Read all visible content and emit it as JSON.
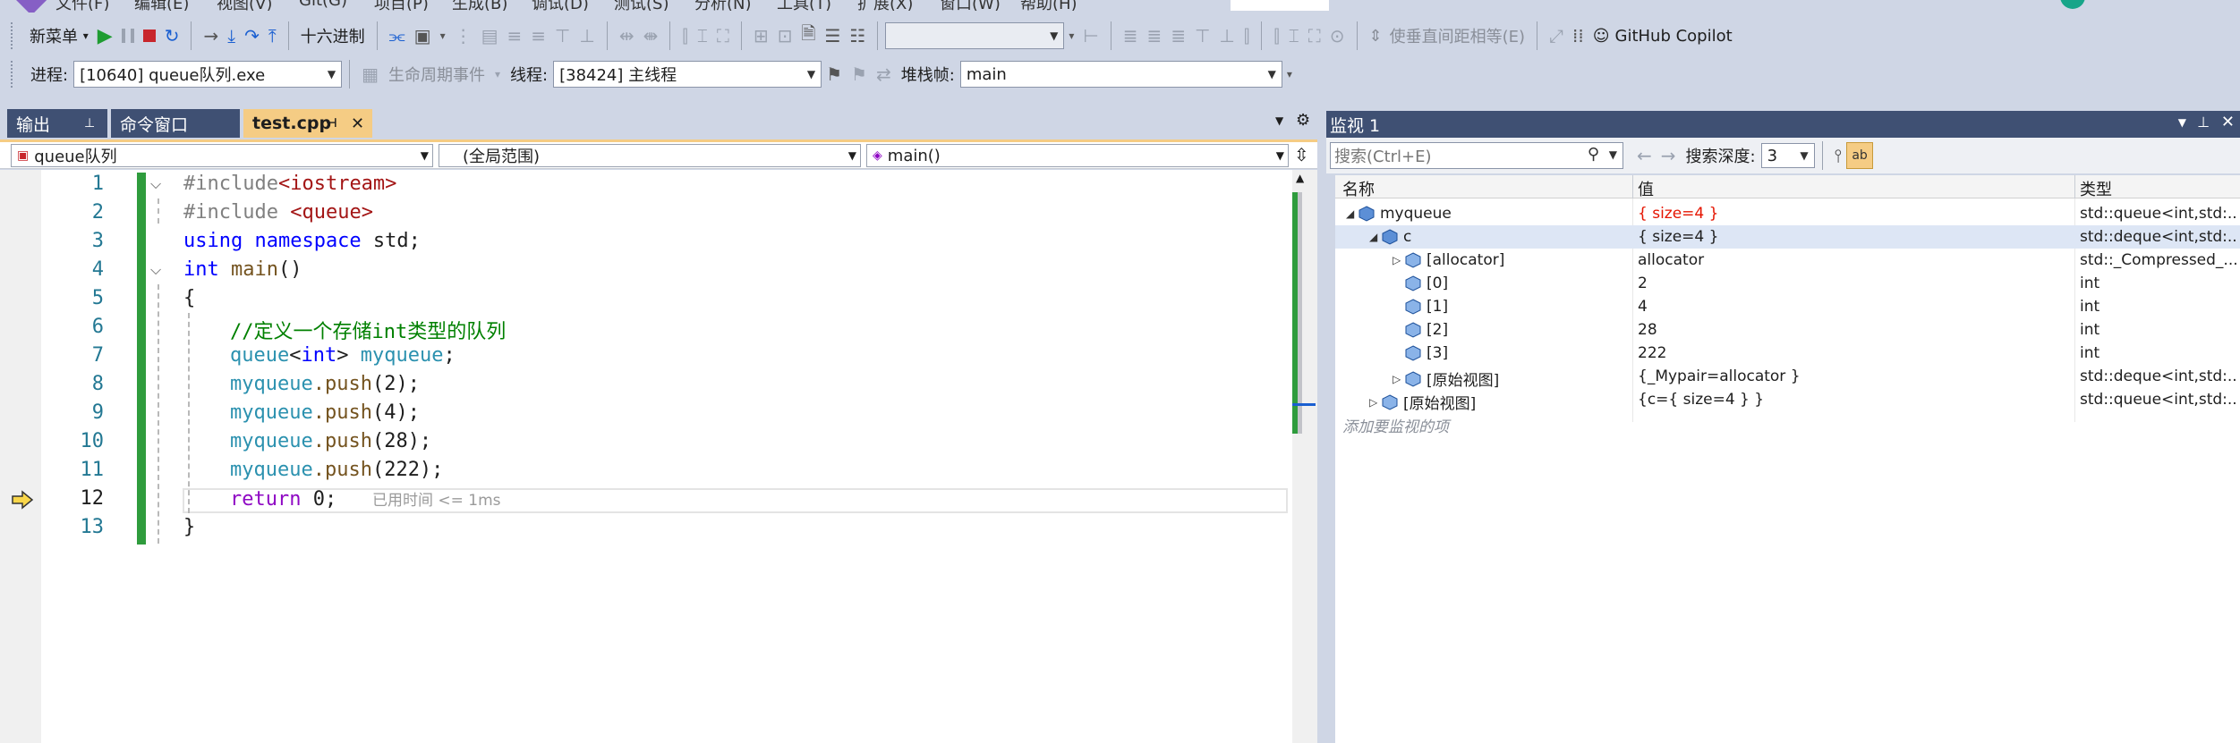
{
  "menu": {
    "items": [
      "文件(F)",
      "编辑(E)",
      "视图(V)",
      "Git(G)",
      "项目(P)",
      "生成(B)",
      "调试(D)",
      "测试(S)",
      "分析(N)",
      "工具(T)",
      "扩展(X)",
      "窗口(W)",
      "帮助(H)"
    ]
  },
  "toolbar1": {
    "new_menu": "新菜单",
    "hex_label": "十六进制",
    "spacing_label": "使垂直间距相等(E)",
    "copilot_label": "GitHub Copilot"
  },
  "toolbar2": {
    "process_label": "进程:",
    "process_value": "[10640] queue队列.exe",
    "lifecycle_label": "生命周期事件",
    "thread_label": "线程:",
    "thread_value": "[38424] 主线程",
    "stackframe_label": "堆栈帧:",
    "stackframe_value": "main"
  },
  "doc_tabs": {
    "output": "输出",
    "command": "命令窗口",
    "file": "test.cpp"
  },
  "nav": {
    "project": "queue队列",
    "scope": "(全局范围)",
    "member": "main()"
  },
  "editor": {
    "line_numbers": [
      "1",
      "2",
      "3",
      "4",
      "5",
      "6",
      "7",
      "8",
      "9",
      "10",
      "11",
      "12",
      "13"
    ],
    "lines": {
      "l1_pp": "#include",
      "l1_inc": "<iostream>",
      "l2_pp": "#include ",
      "l2_inc": "<queue>",
      "l3_kw": "using namespace",
      "l3_rest": " std;",
      "l4_kw": "int",
      "l4_fn": " main",
      "l4_rest": "()",
      "l5": "{",
      "l6_cm": "//定义一个存储int类型的队列",
      "l7_ty": "queue",
      "l7_b": "<",
      "l7_kw": "int",
      "l7_c": "> ",
      "l7_var": "myqueue",
      "l7_end": ";",
      "l8_var": "myqueue",
      "l8_fn": ".push",
      "l8_rest": "(2);",
      "l9_var": "myqueue",
      "l9_fn": ".push",
      "l9_rest": "(4);",
      "l10_var": "myqueue",
      "l10_fn": ".push",
      "l10_rest": "(28);",
      "l11_var": "myqueue",
      "l11_fn": ".push",
      "l11_rest": "(222);",
      "l12_kw": "return",
      "l12_rest": " 0;",
      "l12_hint": "已用时间 <= 1ms",
      "l13": "}"
    }
  },
  "watch": {
    "title": "监视 1",
    "search_placeholder": "搜索(Ctrl+E)",
    "depth_label": "搜索深度:",
    "depth_value": "3",
    "col_name": "名称",
    "col_value": "值",
    "col_type": "类型",
    "rows": [
      {
        "name": "myqueue",
        "value": "{ size=4 }",
        "type": "std::queue<int,std:..."
      },
      {
        "name": "c",
        "value": "{ size=4 }",
        "type": "std::deque<int,std:..."
      },
      {
        "name": "[allocator]",
        "value": "allocator",
        "type": "std::_Compressed_..."
      },
      {
        "name": "[0]",
        "value": "2",
        "type": "int"
      },
      {
        "name": "[1]",
        "value": "4",
        "type": "int"
      },
      {
        "name": "[2]",
        "value": "28",
        "type": "int"
      },
      {
        "name": "[3]",
        "value": "222",
        "type": "int"
      },
      {
        "name": "[原始视图]",
        "value": "{_Mypair=allocator }",
        "type": "std::deque<int,std:..."
      },
      {
        "name": "[原始视图]",
        "value": "{c={ size=4 } }",
        "type": "std::queue<int,std:..."
      }
    ],
    "add_placeholder": "添加要监视的项"
  },
  "colors": {
    "toolbar_bg": "#cfd6e5",
    "tab_active": "#f5cc84",
    "tab_inactive": "#3f5073",
    "change_bar": "#2f9c3d",
    "changed_value": "#e51400"
  }
}
